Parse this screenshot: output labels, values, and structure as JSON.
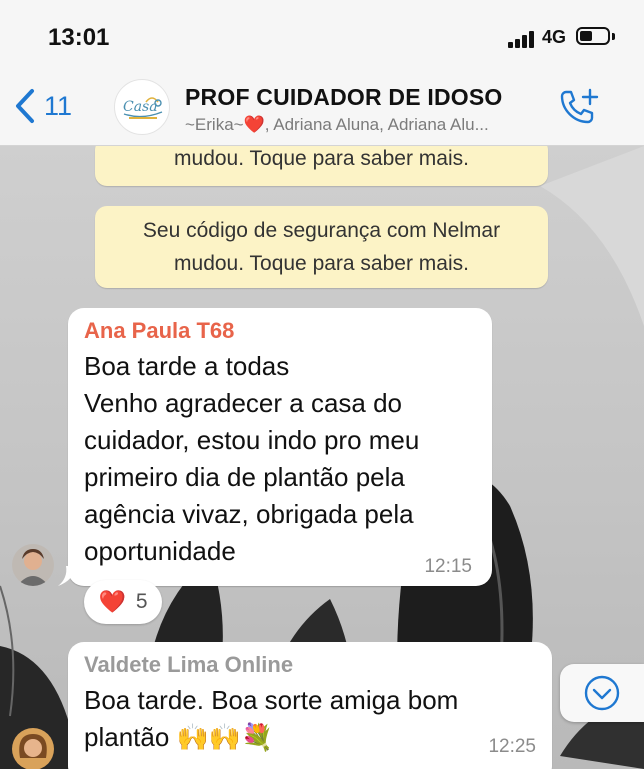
{
  "status_bar": {
    "time": "13:01",
    "network": "4G",
    "battery_level": 0.45
  },
  "header": {
    "back_count": "11",
    "title": "PROF CUIDADOR DE IDOSO",
    "members": "~Erika~❤️, Adriana Aluna, Adriana Alu...",
    "avatar_logo_text": "Casa do Cuidador",
    "icons": {
      "back": "chevron-left-icon",
      "call": "add-call-icon"
    }
  },
  "chat": {
    "notices": [
      {
        "lines": [
          "mudou. Toque para saber mais."
        ]
      },
      {
        "lines": [
          "Seu código de segurança com Nelmar",
          "mudou. Toque para saber mais."
        ]
      }
    ],
    "messages": [
      {
        "sender": "Ana Paula T68",
        "sender_color": "#e8644a",
        "lines": [
          "Boa tarde a todas",
          "Venho agradecer a casa do",
          "cuidador, estou indo pro meu",
          "primeiro dia de plantão pela",
          "agência vivaz, obrigada pela",
          "oportunidade"
        ],
        "time": "12:15",
        "reaction": {
          "emoji": "❤️",
          "count": "5"
        }
      },
      {
        "sender": "Valdete Lima Online",
        "sender_color": "#9a9a9a",
        "lines": [
          "Boa tarde. Boa sorte amiga bom",
          "plantão 🙌🙌💐"
        ],
        "time": "12:25"
      }
    ],
    "scroll_icon": "chevron-down-circle-icon"
  },
  "colors": {
    "ios_blue": "#1f78d1",
    "notice_bg": "#fcf3c6",
    "bubble_bg": "#ffffff"
  }
}
